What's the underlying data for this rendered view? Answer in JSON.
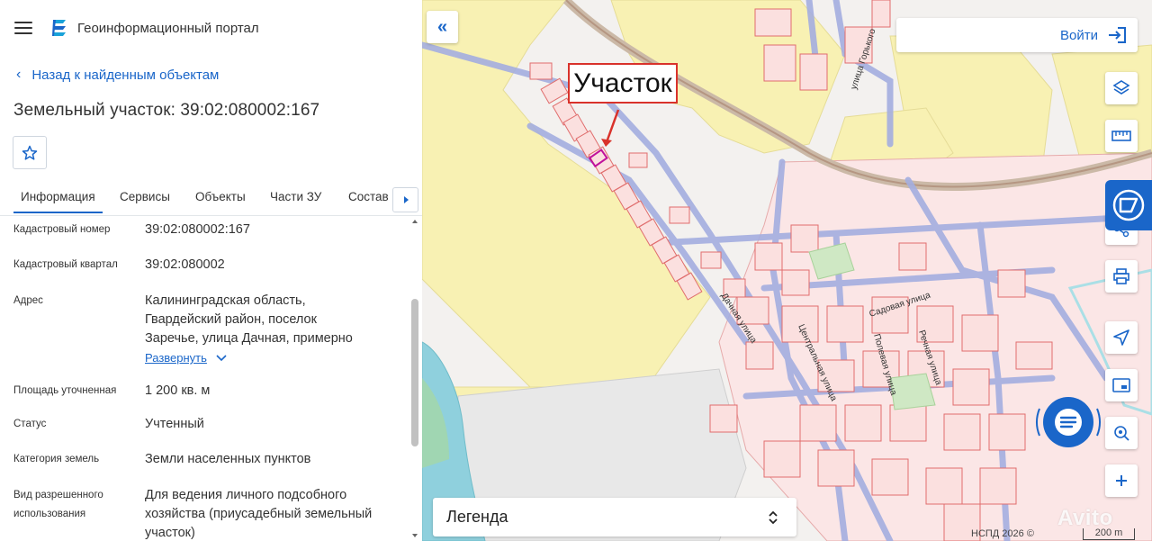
{
  "header": {
    "app_title": "Геоинформационный портал",
    "menu_icon": "hamburger-menu-icon",
    "logo_icon": "portal-logo-icon"
  },
  "back_link": {
    "label": "Назад к найденным объектам"
  },
  "page_title": "Земельный участок: 39:02:080002:167",
  "tabs": [
    {
      "label": "Информация",
      "active": true
    },
    {
      "label": "Сервисы"
    },
    {
      "label": "Объекты"
    },
    {
      "label": "Части ЗУ"
    },
    {
      "label": "Состав"
    }
  ],
  "info_rows": [
    {
      "label": "Кадастровый номер",
      "value": "39:02:080002:167"
    },
    {
      "label": "Кадастровый квартал",
      "value": "39:02:080002"
    },
    {
      "label": "Адрес",
      "value_lines": [
        "Калининградская область,",
        "Гвардейский район, поселок",
        "Заречье, улица Дачная, примерно"
      ],
      "expand_label": "Развернуть"
    },
    {
      "label": "Площадь уточненная",
      "value": "1 200 кв. м"
    },
    {
      "label": "Статус",
      "value": "Учтенный"
    },
    {
      "label": "Категория земель",
      "value": "Земли населенных пунктов"
    },
    {
      "label_lines": [
        "Вид разрешенного",
        "использования"
      ],
      "value_lines": [
        "Для ведения личного подсобного",
        "хозяйства (приусадебный земельный",
        "участок)"
      ]
    }
  ],
  "map": {
    "annotation": "Участок",
    "login_label": "Войти",
    "legend_label": "Легенда",
    "copyright": "НСПД 2026 ©",
    "scale_label": "200 m",
    "watermark": "Avito",
    "streets": [
      "улица Горького",
      "Дачная улица",
      "Садовая улица",
      "Полевая улица",
      "Центральная улица",
      "Речная улица"
    ],
    "colors": {
      "accent": "#1a66c9",
      "annotation_border": "#d9322b",
      "parcel_stroke": "#e06d6d",
      "parcel_fill": "#fbe0df",
      "zone_yellow": "#f8f1b3",
      "road_blue": "#a4aee0",
      "water": "#8fd0dd",
      "selected_parcel": "#c0129c"
    },
    "toolbar_icons": [
      "layers-icon",
      "ruler-icon",
      "share-icon",
      "print-icon",
      "navigate-icon",
      "minimap-icon",
      "search-location-icon",
      "zoom-in-icon"
    ]
  }
}
